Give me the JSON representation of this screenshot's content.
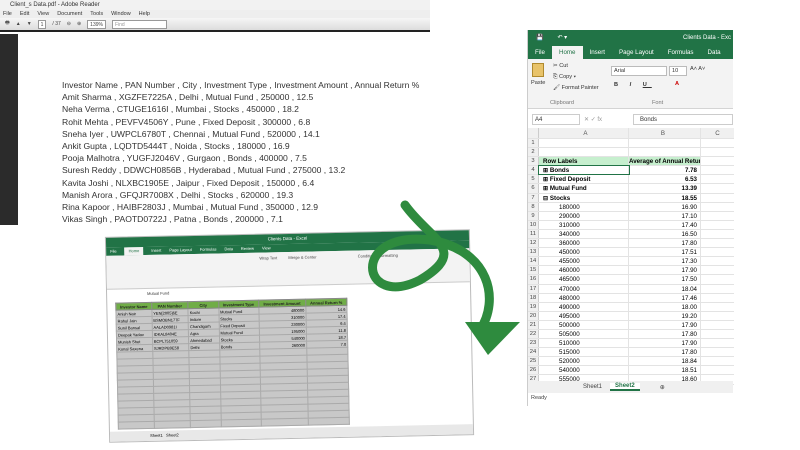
{
  "pdf": {
    "title": "Client_s Data.pdf - Adobe Reader",
    "menu": [
      "File",
      "Edit",
      "View",
      "Document",
      "Tools",
      "Window",
      "Help"
    ],
    "page": "1",
    "page_total": "/ 37",
    "zoom": "139%",
    "find_placeholder": "Find",
    "lines": [
      "Investor Name , PAN Number , City , Investment Type , Investment Amount , Annual Return %",
      "Amit Sharma , XGZFE7225A , Delhi , Mutual Fund , 250000 , 12.5",
      "Neha Verma , CTUGE1616I , Mumbai , Stocks , 450000 , 18.2",
      "Rohit Mehta , PEVFV4506Y , Pune , Fixed Deposit , 300000 , 6.8",
      "Sneha Iyer , UWPCL6780T , Chennai , Mutual Fund , 520000 , 14.1",
      "Ankit Gupta , LQDTD5444T , Noida , Stocks , 180000 , 16.9",
      "Pooja Malhotra , YUGFJ2046V , Gurgaon , Bonds , 400000 , 7.5",
      "Suresh Reddy , DDWCH0856B , Hyderabad , Mutual Fund , 275000 , 13.2",
      "Kavita Joshi , NLXBC1905E , Jaipur , Fixed Deposit , 150000 , 6.4",
      "Manish Arora , GFQJR7008X , Delhi , Stocks , 620000 , 19.3",
      "Rina Kapoor , HAIBF2803J , Mumbai , Mutual Fund , 350000 , 12.9",
      "Vikas Singh , PAOTD0722J , Patna , Bonds , 200000 , 7.1"
    ]
  },
  "excel": {
    "title": "Clients Data - Exc",
    "tabs": [
      "File",
      "Home",
      "Insert",
      "Page Layout",
      "Formulas",
      "Data"
    ],
    "ribbon": {
      "cut": "Cut",
      "copy": "Copy",
      "format_painter": "Format Painter",
      "paste": "Paste",
      "clipboard": "Clipboard",
      "font": "Font",
      "font_name": "Arial",
      "font_size": "10"
    },
    "name_box": "A4",
    "formula": "Bonds",
    "columns": [
      "A",
      "B",
      "C"
    ],
    "pivot_header": [
      "Row Labels",
      "Average of  Annual Return %"
    ],
    "groups": [
      {
        "label": "Bonds",
        "value": "7.78"
      },
      {
        "label": "Fixed Deposit",
        "value": "6.53"
      },
      {
        "label": "Mutual Fund",
        "value": "13.39"
      },
      {
        "label": "Stocks",
        "value": "18.55"
      }
    ],
    "stock_rows": [
      [
        "180000",
        "16.90"
      ],
      [
        "290000",
        "17.10"
      ],
      [
        "310000",
        "17.40"
      ],
      [
        "340000",
        "16.50"
      ],
      [
        "360000",
        "17.80"
      ],
      [
        "450000",
        "17.51"
      ],
      [
        "455000",
        "17.30"
      ],
      [
        "460000",
        "17.90"
      ],
      [
        "465000",
        "17.50"
      ],
      [
        "470000",
        "18.04"
      ],
      [
        "480000",
        "17.46"
      ],
      [
        "490000",
        "18.00"
      ],
      [
        "495000",
        "19.20"
      ],
      [
        "500000",
        "17.90"
      ],
      [
        "505000",
        "17.80"
      ],
      [
        "510000",
        "17.90"
      ],
      [
        "515000",
        "17.80"
      ],
      [
        "520000",
        "18.84"
      ],
      [
        "540000",
        "18.51"
      ],
      [
        "555000",
        "18.60"
      ]
    ],
    "sheets": [
      "Sheet1",
      "Sheet2"
    ],
    "status": "Ready"
  },
  "small_excel": {
    "title": "Clients Data - Excel",
    "tabs": [
      "File",
      "Home",
      "Insert",
      "Page Layout",
      "Formulas",
      "Data",
      "Review",
      "View"
    ],
    "formula": "Mutual Fund",
    "wrap_text": "Wrap Text",
    "merge": "Merge & Center",
    "conditional": "Conditional Formatting",
    "headers": [
      "Investor Name",
      "PAN Number",
      "City",
      "Investment Type",
      "Investment Amount",
      "Annual Return %"
    ],
    "rows": [
      [
        "Anish Nair",
        "YEN[2005]6E",
        "Kochi",
        "Mutual Fund",
        "480000",
        "14.6"
      ],
      [
        "Rahul Jain",
        "BSMOBN177F",
        "Indore",
        "Stocks",
        "310000",
        "17.4"
      ],
      [
        "Sunil Bansal",
        "AALAD0981I",
        "Chandigarh",
        "Fixed Deposit",
        "230000",
        "6.4"
      ],
      [
        "Deepak Yadav",
        "IDKAL8404E",
        "Agra",
        "Mutual Fund",
        "195000",
        "11.8"
      ],
      [
        "Munish Shet",
        "BCPL751059",
        "Ahmedabad",
        "Stocks",
        "540000",
        "18.7"
      ],
      [
        "Kunal Saxena",
        "SJRDPB9E58",
        "Delhi",
        "Bonds",
        "260000",
        "7.0"
      ]
    ],
    "sheets": [
      "Sheet1",
      "Sheet2"
    ]
  }
}
